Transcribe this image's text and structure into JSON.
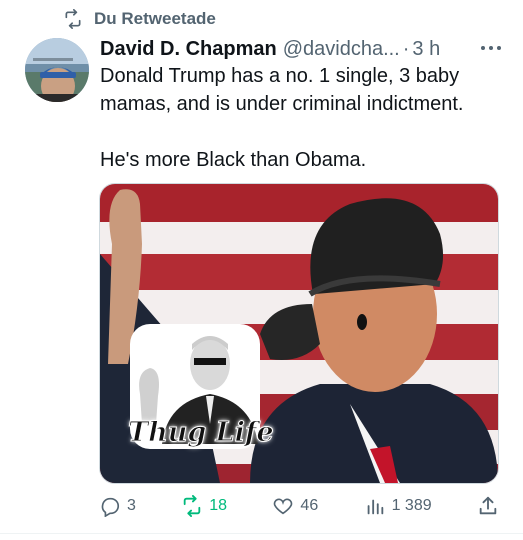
{
  "retweet_header": {
    "text": "Du Retweetade",
    "icon": "retweet-icon"
  },
  "tweet": {
    "author_name": "David D. Chapman",
    "handle": "@davidcha...",
    "separator": "·",
    "time": "3 h",
    "more_icon": "more-icon",
    "text_lines": [
      "Donald Trump has a no. 1 single, 3 baby mamas, and is under criminal indictment.",
      "He's more Black than Obama."
    ],
    "media": {
      "sticker_text": "Thug Life"
    }
  },
  "actions": {
    "replies": "3",
    "retweets": "18",
    "likes": "46",
    "views": "1 389",
    "icons": [
      "reply-icon",
      "retweet-icon",
      "like-icon",
      "views-icon",
      "share-icon"
    ]
  },
  "colors": {
    "text": "#0f1419",
    "secondary": "#536471",
    "retweet_green": "#00ba7c",
    "border": "#cfd9de"
  }
}
